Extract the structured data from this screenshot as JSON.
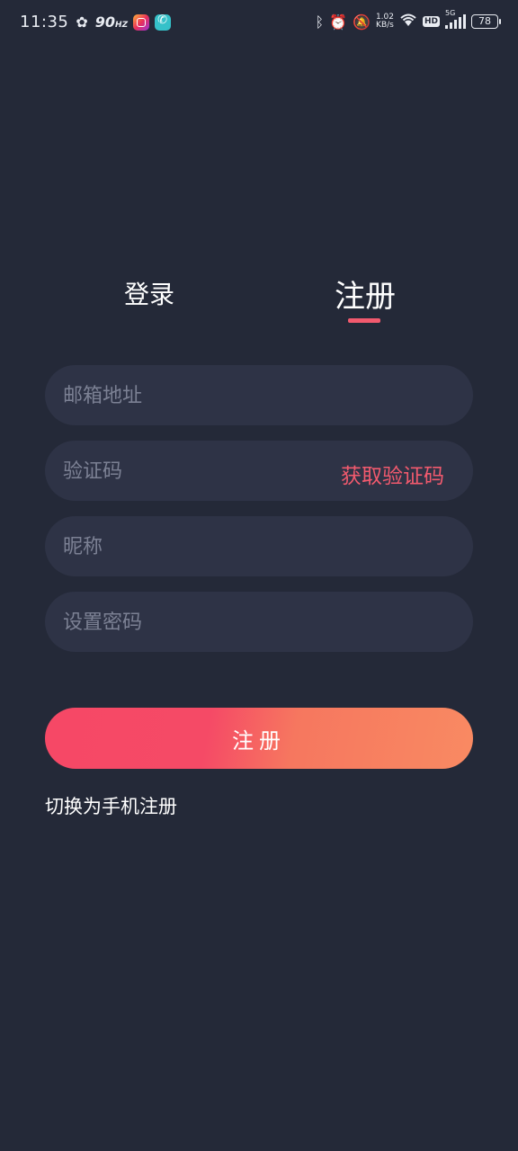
{
  "status_bar": {
    "time": "11:35",
    "refresh_rate": "90",
    "refresh_unit": "HZ",
    "net_speed": "1.02",
    "net_unit": "KB/s",
    "hd": "HD",
    "network": "5G",
    "battery": "78"
  },
  "tabs": {
    "login": "登录",
    "register": "注册",
    "active": "register",
    "accent": "#f25a6e"
  },
  "form": {
    "email_placeholder": "邮箱地址",
    "code_placeholder": "验证码",
    "get_code": "获取验证码",
    "nickname_placeholder": "昵称",
    "password_placeholder": "设置密码"
  },
  "submit_label": "注册",
  "switch_link": "切换为手机注册",
  "colors": {
    "background": "#242938",
    "field": "#2e3346",
    "placeholder": "#7c8194",
    "gradient_start": "#f64866",
    "gradient_end": "#f98a62"
  },
  "icons": [
    "pinwheel-icon",
    "instagram-icon",
    "phone-app-icon",
    "bluetooth-icon",
    "alarm-icon",
    "mute-bell-icon",
    "wifi-icon",
    "signal-icon",
    "battery-icon"
  ]
}
